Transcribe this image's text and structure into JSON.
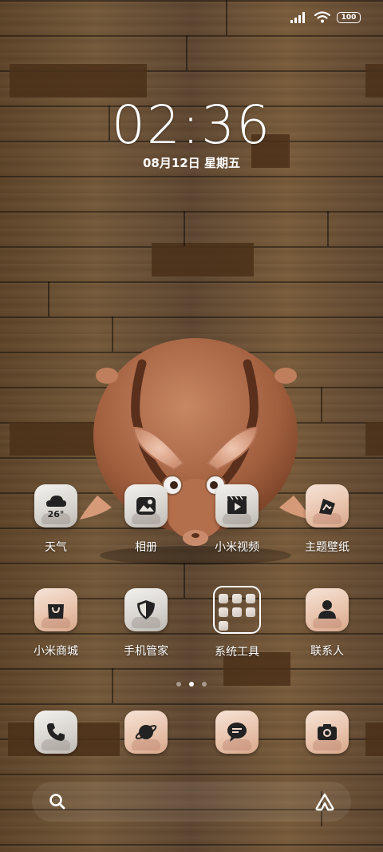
{
  "status_bar": {
    "battery": "100",
    "signal_icon": "signal-bars-icon",
    "wifi_icon": "wifi-icon"
  },
  "lock": {
    "time": "02:36",
    "date": "08月12日 星期五"
  },
  "apps_row1": [
    {
      "label": "天气",
      "icon": "weather-cloud-icon",
      "temp": "26°",
      "style": "gray"
    },
    {
      "label": "相册",
      "icon": "gallery-icon",
      "style": "gray"
    },
    {
      "label": "小米视频",
      "icon": "video-clapper-icon",
      "style": "gray"
    },
    {
      "label": "主题壁纸",
      "icon": "theme-icon",
      "style": "pink"
    }
  ],
  "apps_row2": [
    {
      "label": "小米商城",
      "icon": "shopping-bag-icon",
      "style": "pink"
    },
    {
      "label": "手机管家",
      "icon": "security-shield-icon",
      "style": "gray"
    },
    {
      "label": "系统工具",
      "icon": "folder-icon",
      "style": "folder"
    },
    {
      "label": "联系人",
      "icon": "contact-person-icon",
      "style": "pink"
    }
  ],
  "dock": [
    {
      "name": "phone",
      "icon": "phone-icon",
      "style": "gray"
    },
    {
      "name": "browser",
      "icon": "browser-planet-icon",
      "style": "pink"
    },
    {
      "name": "messages",
      "icon": "message-bubble-icon",
      "style": "pink"
    },
    {
      "name": "camera",
      "icon": "camera-icon",
      "style": "pink"
    }
  ],
  "page_indicator": {
    "total": 3,
    "current": 2
  },
  "search": {
    "left_icon": "search-icon",
    "right_icon": "assistant-icon"
  }
}
